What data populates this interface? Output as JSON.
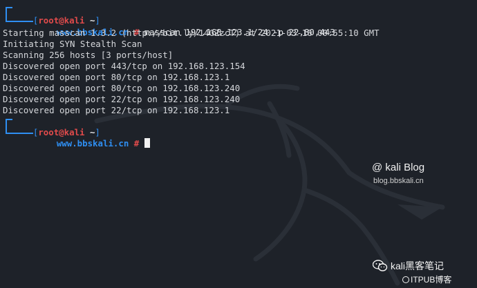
{
  "prompt": {
    "user": "root",
    "at": "@",
    "host": "kali",
    "open_bracket": "[",
    "close_bracket": "]",
    "cwd": "~",
    "subline": "www.bbskali.cn",
    "symbol": "#"
  },
  "command": "masscan 192.168.123.1/24 -p 22,80,443",
  "output": [
    "Starting masscan 1.3.2 (http://bit.ly/14GZzcT) at 2021-03-16 00:55:10 GMT",
    "Initiating SYN Stealth Scan",
    "Scanning 256 hosts [3 ports/host]",
    "Discovered open port 443/tcp on 192.168.123.154",
    "Discovered open port 80/tcp on 192.168.123.1",
    "Discovered open port 80/tcp on 192.168.123.240",
    "Discovered open port 22/tcp on 192.168.123.240",
    "Discovered open port 22/tcp on 192.168.123.1"
  ],
  "watermark": {
    "blog_title": "@ kali Blog",
    "blog_url": "blog.bbskali.cn",
    "wechat_name": "kali黑客笔记",
    "itpub_label": "ITPUB博客"
  },
  "colors": {
    "background": "#1e2229",
    "prompt_blue": "#2f8ff2",
    "prompt_red": "#e24b4b",
    "text": "#d6d8dc"
  }
}
